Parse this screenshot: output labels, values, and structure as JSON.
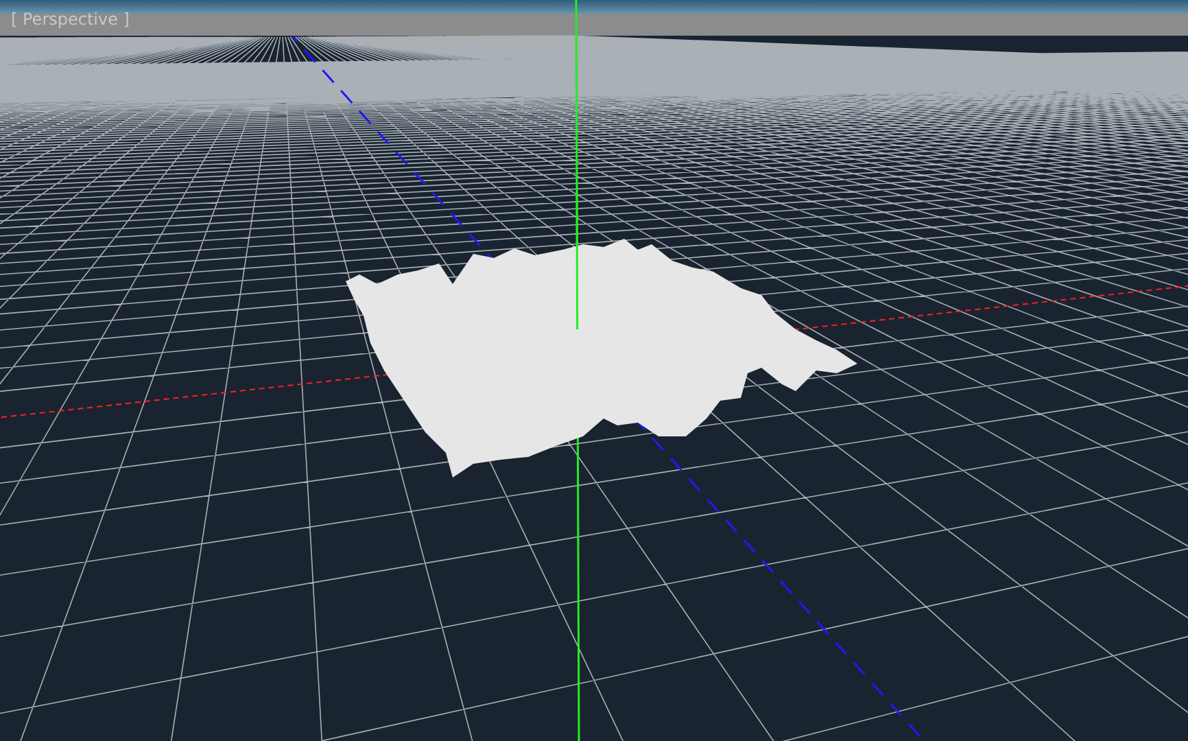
{
  "viewport": {
    "label": "[ Perspective ]"
  }
}
